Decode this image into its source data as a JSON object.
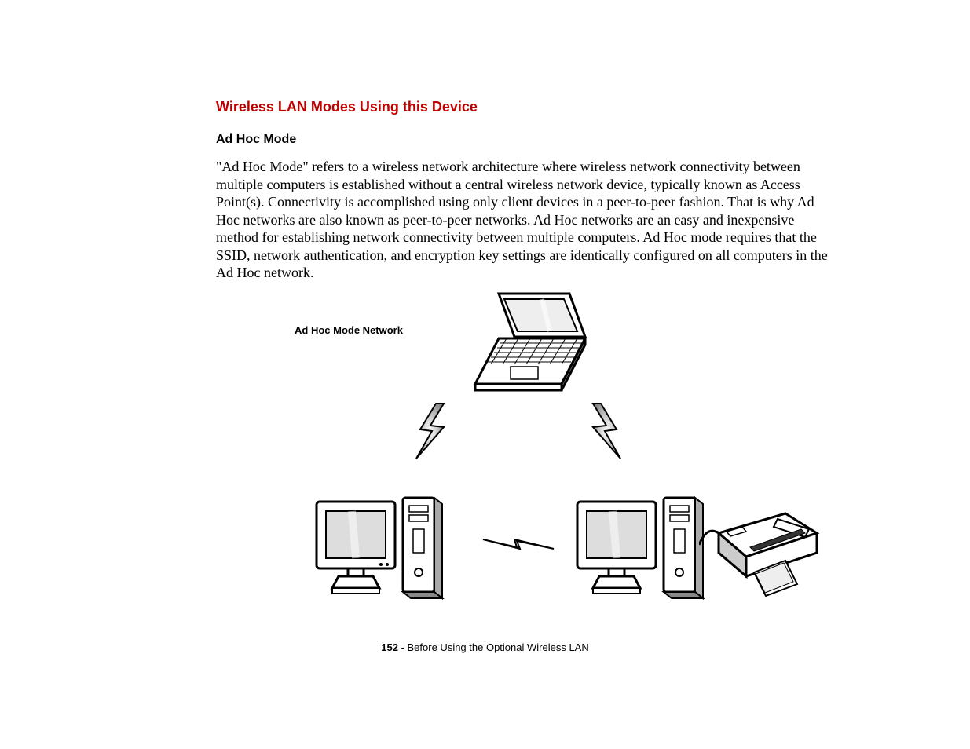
{
  "section_title": "Wireless LAN Modes Using this Device",
  "subsection_title": "Ad Hoc Mode",
  "body_text": "\"Ad Hoc Mode\" refers to a wireless network architecture where wireless network connectivity between multiple computers is established without a central wireless network device, typically known as Access Point(s). Connectivity is accomplished using only client devices in a peer-to-peer fashion. That is why Ad Hoc networks are also known as peer-to-peer networks. Ad Hoc networks are an easy and inexpensive method for establishing network connectivity between multiple computers. Ad Hoc mode requires that the SSID, network authentication, and encryption key settings are identically configured on all computers in the Ad Hoc network.",
  "diagram": {
    "label": "Ad Hoc Mode Network",
    "devices": [
      "laptop",
      "desktop-left",
      "desktop-right",
      "printer"
    ],
    "links": [
      "laptop-to-desktop-left",
      "laptop-to-desktop-right",
      "desktop-to-desktop"
    ]
  },
  "footer": {
    "page_number": "152",
    "separator": " - ",
    "chapter": "Before Using the Optional Wireless LAN"
  }
}
